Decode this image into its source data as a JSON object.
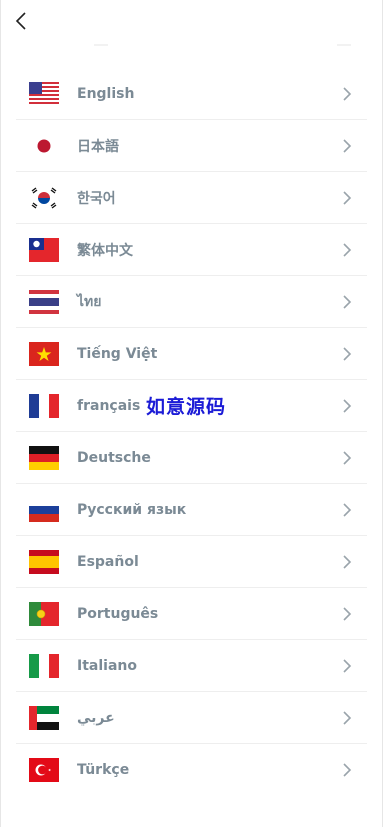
{
  "header": {
    "back_icon": "chevron-left-icon"
  },
  "languages": [
    {
      "label": "English",
      "flag": "us"
    },
    {
      "label": "日本語",
      "flag": "jp"
    },
    {
      "label": "한국어",
      "flag": "kr"
    },
    {
      "label": "繁体中文",
      "flag": "tw"
    },
    {
      "label": "ไทย",
      "flag": "th"
    },
    {
      "label": "Tiếng Việt",
      "flag": "vn"
    },
    {
      "label": "français",
      "flag": "fr"
    },
    {
      "label": "Deutsche",
      "flag": "de"
    },
    {
      "label": "Русский язык",
      "flag": "ru"
    },
    {
      "label": "Español",
      "flag": "es"
    },
    {
      "label": "Português",
      "flag": "pt"
    },
    {
      "label": "Italiano",
      "flag": "it"
    },
    {
      "label": "عربي",
      "flag": "ae"
    },
    {
      "label": "Türkçe",
      "flag": "tr"
    }
  ],
  "watermark": "如意源码",
  "colors": {
    "label": "#7b8a95",
    "chevron": "#9aa4ab",
    "watermark": "#1b1bd6",
    "divider": "#eeeeee"
  }
}
